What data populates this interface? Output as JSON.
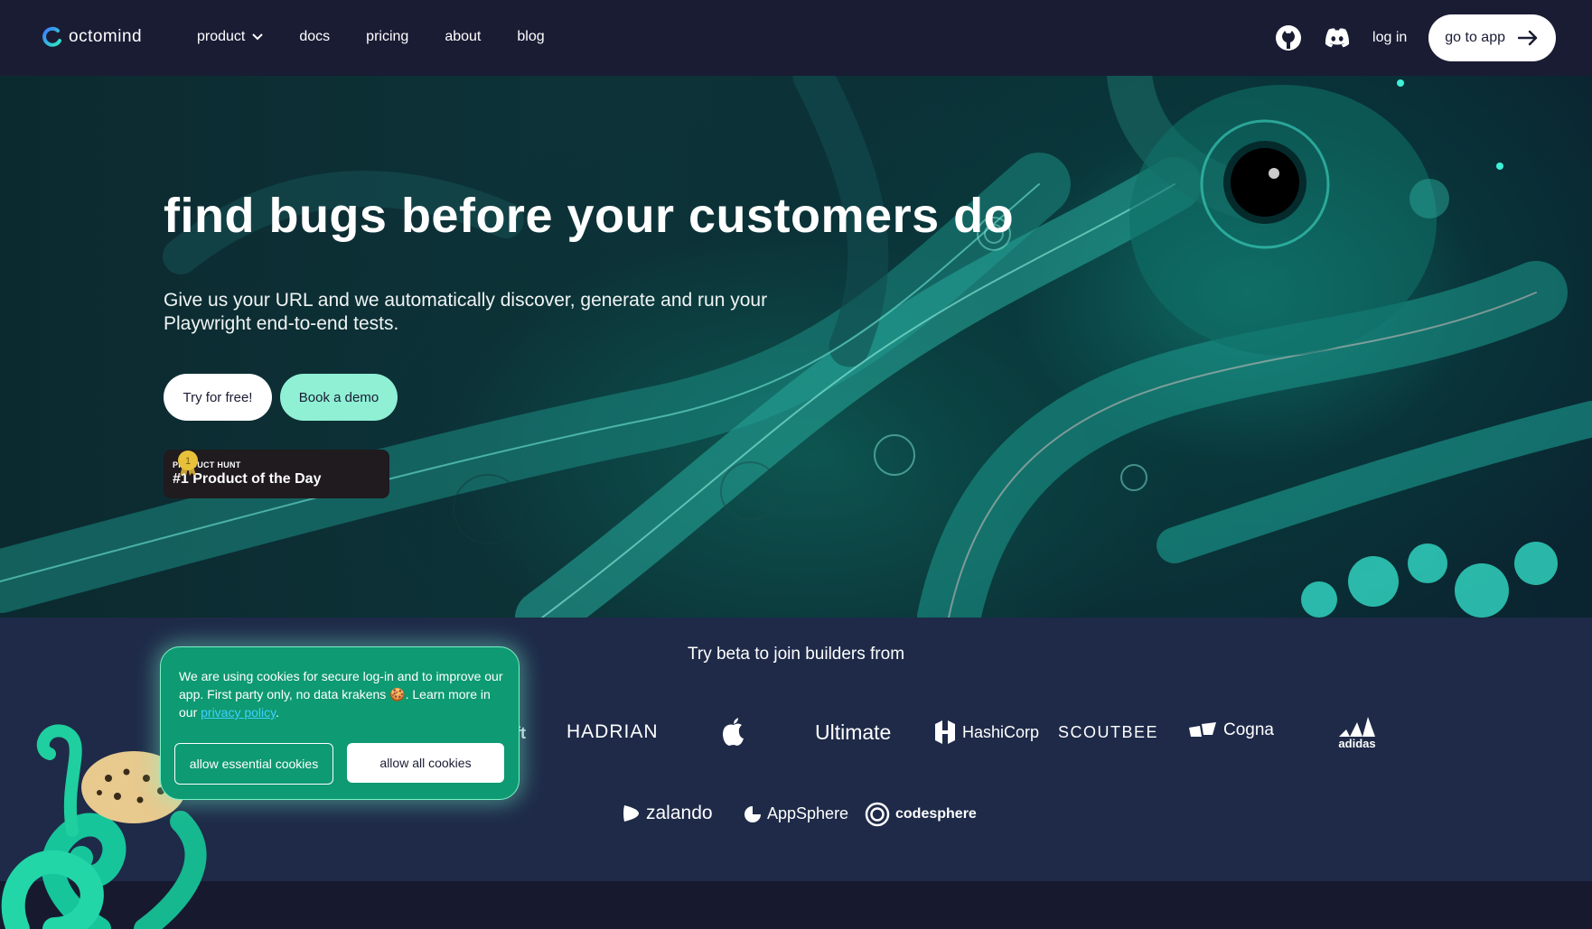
{
  "nav": {
    "logo_text": "octomind",
    "links": [
      {
        "label": "product"
      },
      {
        "label": "docs"
      },
      {
        "label": "pricing"
      },
      {
        "label": "about"
      },
      {
        "label": "blog"
      }
    ],
    "icons": [
      "github-icon",
      "discord-icon"
    ],
    "login_label": "log in",
    "goto_label": "go to app"
  },
  "hero": {
    "headline": "find bugs before your customers do",
    "subtitle": "Give us your URL and we automatically discover, generate and run your Playwright end-to-end tests.",
    "try_label": "Try for free!",
    "demo_label": "Book a demo",
    "product_hunt": {
      "small": "PRODUCT HUNT",
      "big": "#1 Product of the Day",
      "medal_number": "1"
    }
  },
  "strip": {
    "title": "Try beta to join builders from",
    "brands_row1": [
      "ft",
      "HADRIAN",
      "apple",
      "Ultimate",
      "HashiCorp",
      "SCOUTBEE",
      "Cogna",
      "adidas"
    ],
    "brands_row2": [
      "zalando",
      "AppSphere",
      "codesphere"
    ]
  },
  "cookie": {
    "text": "We are using cookies for secure log-in and to improve our app.  First party only, no data krakens 🍪. Learn more in our ",
    "link": "privacy policy",
    "suffix": ".",
    "essential_label": "allow essential cookies",
    "all_label": "allow all cookies"
  },
  "colors": {
    "nav_bg": "#1a1c34",
    "accent_mint": "#8ff0d4",
    "cookie_green": "#0e9a72",
    "strip_bg": "#1e2a48"
  }
}
